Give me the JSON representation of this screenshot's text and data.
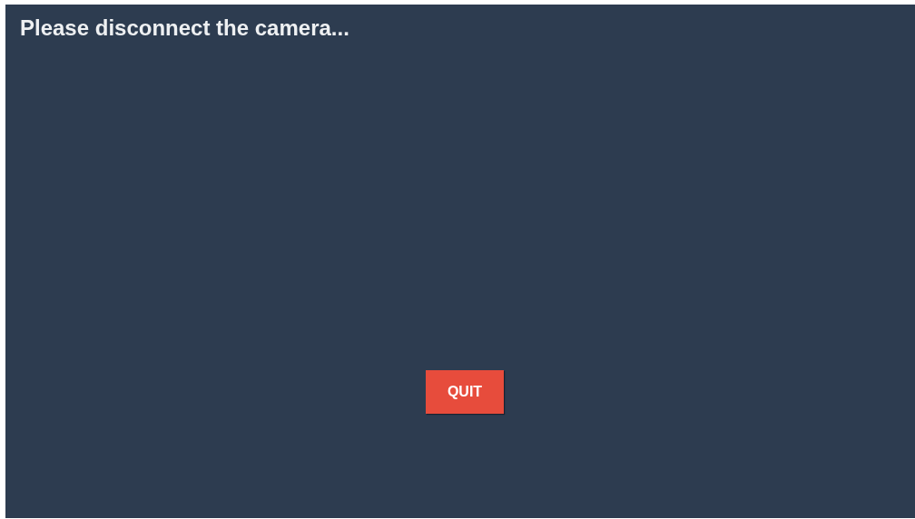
{
  "message": {
    "title": "Please disconnect the camera..."
  },
  "buttons": [
    {
      "label": "QUIT",
      "kind": "danger"
    }
  ]
}
